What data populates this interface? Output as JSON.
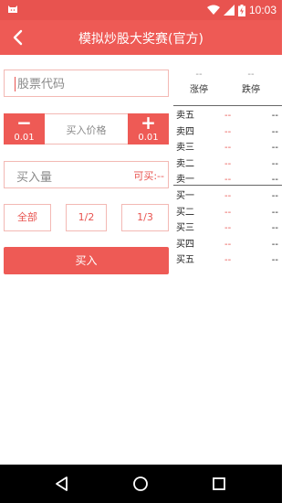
{
  "status_bar": {
    "time": "10:03"
  },
  "app_bar": {
    "title": "模拟炒股大奖赛(官方)"
  },
  "form": {
    "stock_code_placeholder": "股票代码",
    "price_minus_symbol": "−",
    "price_plus_symbol": "+",
    "price_step_minus": "0.01",
    "price_step_plus": "0.01",
    "price_label": "买入价格",
    "quantity_label": "买入量",
    "available_label": "可买:--",
    "fractions": {
      "all": "全部",
      "half": "1/2",
      "third": "1/3"
    },
    "buy_button": "买入"
  },
  "quote": {
    "limit_up_value": "--",
    "limit_up_label": "涨停",
    "limit_down_value": "--",
    "limit_down_label": "跌停"
  },
  "order_book": {
    "sells": [
      {
        "level": "卖五",
        "price": "--",
        "volume": "--"
      },
      {
        "level": "卖四",
        "price": "--",
        "volume": "--"
      },
      {
        "level": "卖三",
        "price": "--",
        "volume": "--"
      },
      {
        "level": "卖二",
        "price": "--",
        "volume": "--"
      },
      {
        "level": "卖一",
        "price": "--",
        "volume": "--"
      }
    ],
    "buys": [
      {
        "level": "买一",
        "price": "--",
        "volume": "--"
      },
      {
        "level": "买二",
        "price": "--",
        "volume": "--"
      },
      {
        "level": "买三",
        "price": "--",
        "volume": "--"
      },
      {
        "level": "买四",
        "price": "--",
        "volume": "--"
      },
      {
        "level": "买五",
        "price": "--",
        "volume": "--"
      }
    ]
  },
  "icons": {
    "back": "back-arrow-icon",
    "wifi": "wifi-icon",
    "signal": "signal-icon",
    "battery": "battery-icon",
    "nav_back": "nav-back-icon",
    "nav_home": "nav-home-icon",
    "nav_recent": "nav-recent-icon"
  },
  "colors": {
    "primary": "#ee5a55",
    "status_bar": "#e8534f",
    "accent_text": "#e8534f",
    "border": "#f3b9b4",
    "nav_bar": "#000000"
  }
}
